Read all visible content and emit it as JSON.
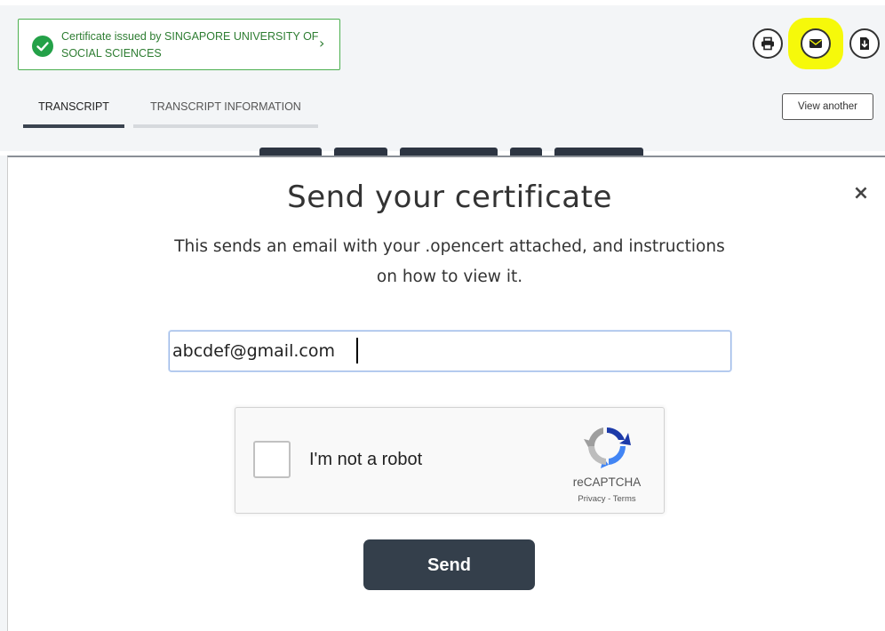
{
  "header": {
    "issuer_text": "Certificate issued by SINGAPORE UNIVERSITY OF SOCIAL SCIENCES",
    "issuer_chevron": "›",
    "actions": [
      {
        "name": "print",
        "icon": "print-icon"
      },
      {
        "name": "email",
        "icon": "envelope-icon",
        "highlighted": true
      },
      {
        "name": "download",
        "icon": "download-file-icon"
      }
    ],
    "highlight_color": "#f6f90a",
    "view_another_label": "View another"
  },
  "tabs": [
    {
      "label": "TRANSCRIPT",
      "active": true
    },
    {
      "label": "TRANSCRIPT INFORMATION",
      "active": false
    }
  ],
  "modal": {
    "title": "Send your certificate",
    "close_label": "×",
    "description": "This sends an email with your .opencert attached, and instructions on how to view it.",
    "email_value": "abcdef@gmail.com",
    "send_label": "Send",
    "accent_color": "#343f4b"
  },
  "recaptcha": {
    "label": "I'm not a robot",
    "brand": "reCAPTCHA",
    "links": "Privacy - Terms",
    "checked": false
  }
}
